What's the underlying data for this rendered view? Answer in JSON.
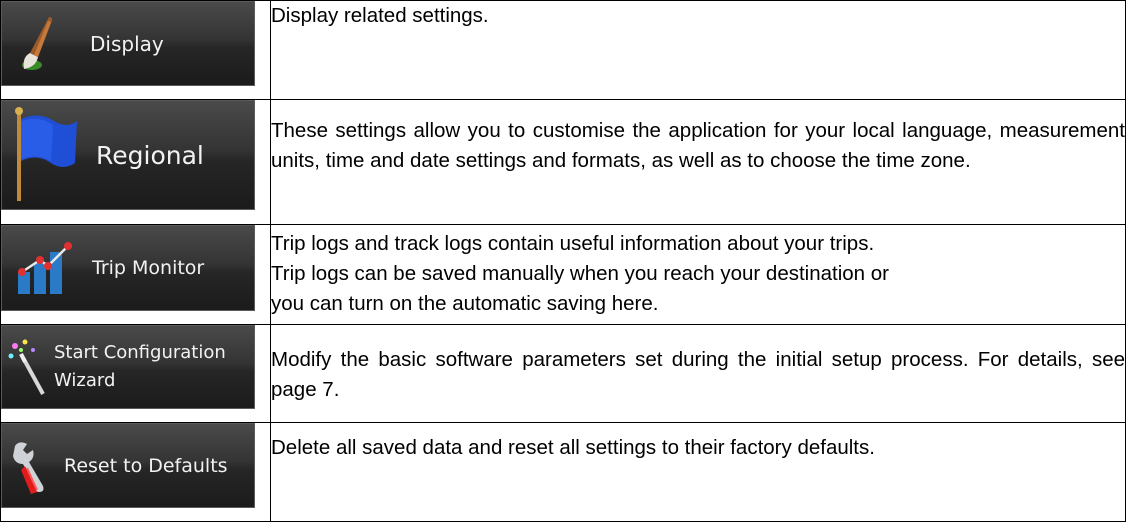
{
  "rows": [
    {
      "button_label": "Display",
      "icon": "paintbrush-icon",
      "description": "Display related settings."
    },
    {
      "button_label": "Regional",
      "icon": "flag-icon",
      "description": "These settings allow you to customise the application for your local language, measurement units, time and date settings and formats, as well as to choose the time zone."
    },
    {
      "button_label": "Trip Monitor",
      "icon": "bar-chart-icon",
      "description_lines": [
        "Trip logs and track logs contain useful information about your trips.",
        "Trip logs can be saved manually when you reach your destination or",
        "you can turn on the automatic saving here."
      ]
    },
    {
      "button_label_lines": [
        "Start Configuration",
        "Wizard"
      ],
      "icon": "magic-wand-icon",
      "description": "Modify the basic software parameters set during the initial setup process. For details, see page 7."
    },
    {
      "button_label": "Reset to Defaults",
      "icon": "wrench-icon",
      "description": "Delete all saved data and reset all settings to their factory defaults."
    }
  ]
}
